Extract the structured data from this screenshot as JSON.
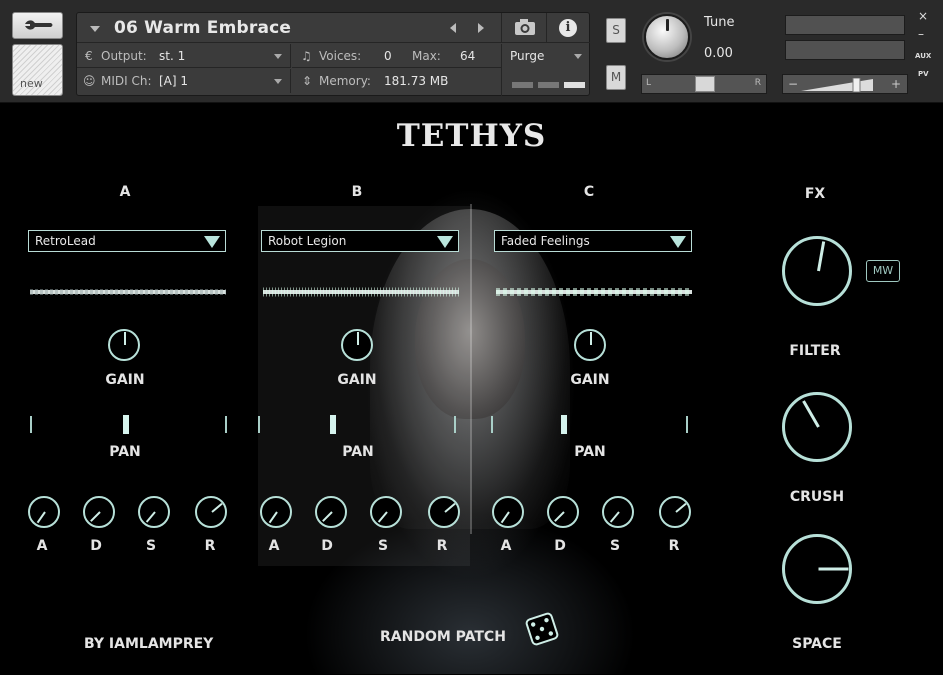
{
  "header": {
    "new_label": "new",
    "instrument_name": "06 Warm Embrace",
    "output_label": "Output:",
    "output_value": "st. 1",
    "midi_label": "MIDI Ch:",
    "midi_value": "[A]  1",
    "voices_label": "Voices:",
    "voices_value": "0",
    "max_label": "Max:",
    "max_value": "64",
    "memory_label": "Memory:",
    "memory_value": "181.73 MB",
    "purge_label": "Purge",
    "solo_label": "S",
    "mute_label": "M",
    "tune_label": "Tune",
    "tune_value": "0.00",
    "pan_left": "L",
    "pan_right": "R",
    "vol_minus": "−",
    "vol_plus": "+",
    "close": "×",
    "minimize": "–",
    "aux": "AUX",
    "pv": "PV"
  },
  "instrument": {
    "title": "TETHYS",
    "layers": [
      {
        "name": "A",
        "preset": "RetroLead",
        "gain_label": "GAIN",
        "pan_label": "PAN",
        "pan": 0.5,
        "adsr": [
          "A",
          "D",
          "S",
          "R"
        ]
      },
      {
        "name": "B",
        "preset": "Robot Legion",
        "gain_label": "GAIN",
        "pan_label": "PAN",
        "pan": 0.37,
        "adsr": [
          "A",
          "D",
          "S",
          "R"
        ]
      },
      {
        "name": "C",
        "preset": "Faded Feelings",
        "gain_label": "GAIN",
        "pan_label": "PAN",
        "pan": 0.37,
        "adsr": [
          "A",
          "D",
          "S",
          "R"
        ]
      }
    ],
    "fx_label": "FX",
    "filter_label": "FILTER",
    "crush_label": "CRUSH",
    "space_label": "SPACE",
    "mw_label": "MW",
    "credit": "BY IAMLAMPREY",
    "random_label": "RANDOM PATCH",
    "accent_color": "#b7e0d8"
  }
}
